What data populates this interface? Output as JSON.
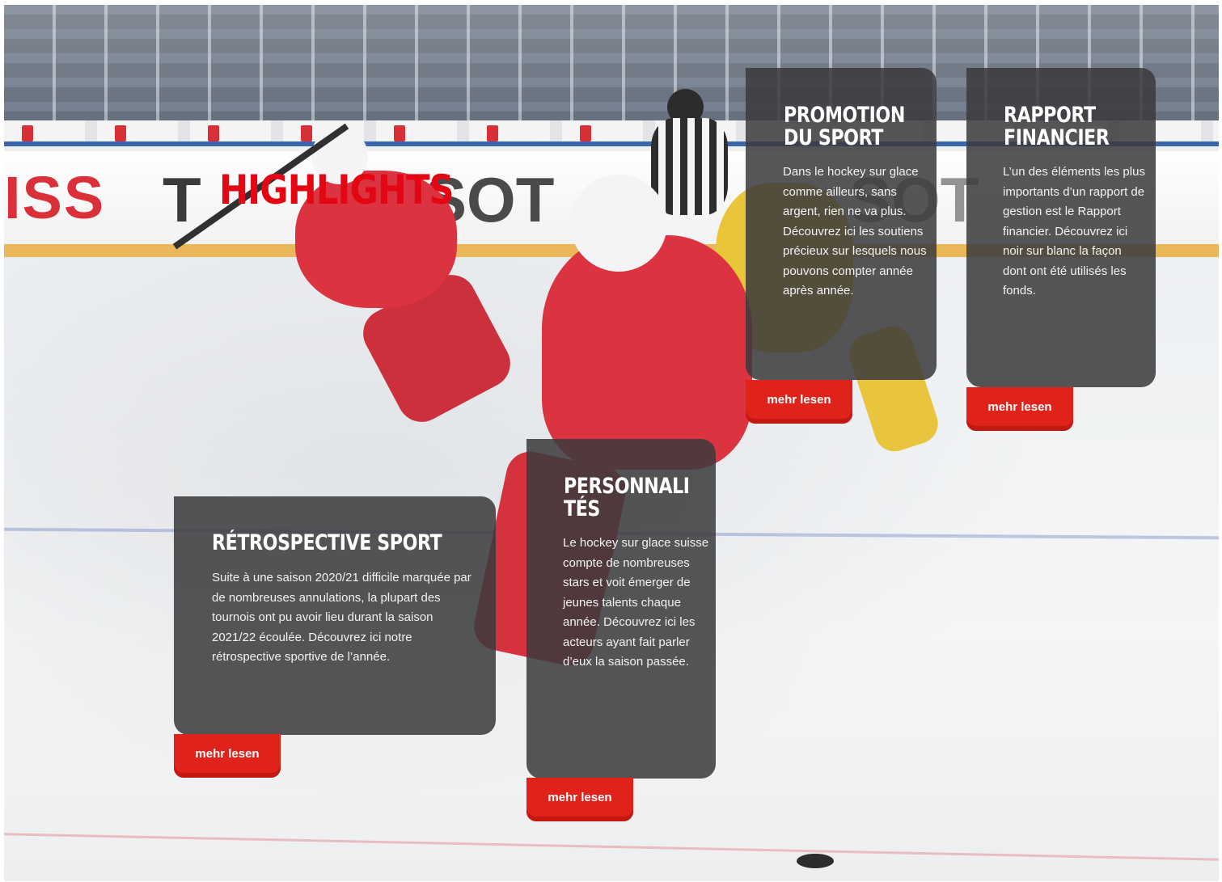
{
  "page": {
    "headline": "HIGHLIGHTS"
  },
  "cards": {
    "promotion": {
      "title": "PROMOTION\nDU SPORT",
      "text": "Dans le hockey sur glace comme ailleurs, sans argent, rien ne va plus. Découvrez ici les soutiens précieux sur lesquels nous pouvons compter année après année.",
      "button": "mehr lesen"
    },
    "rapport": {
      "title": "RAPPORT\nFINANCIER",
      "text": "L’un des éléments les plus importants d’un rapport de gestion est le Rapport financier. Découvrez ici noir sur blanc la façon dont ont été utilisés les fonds.",
      "button": "mehr lesen"
    },
    "retrospective": {
      "title": "RÉTROSPECTIVE SPORT",
      "text": "Suite à une saison 2020/21 difficile marquée par de nombreuses annulations, la plupart des tournois ont pu avoir lieu durant la saison 2021/22 écoulée. Découvrez ici notre rétrospective sportive de l’année.",
      "button": "mehr lesen"
    },
    "personnalites": {
      "title": "PERSONNALI\nTÉS",
      "text": "Le hockey sur glace suisse compte de nombreuses stars et voit émerger de jeunes talents chaque année. Découvrez ici les acteurs ayant fait parler d’eux la saison passée.",
      "button": "mehr lesen"
    }
  },
  "background": {
    "board_text_left": "ISS",
    "board_text_mid": "T",
    "board_text_right": "SOT",
    "board_text_far": "SOT"
  },
  "colors": {
    "accent_red": "#e30613",
    "button_red": "#e0231a",
    "card_bg": "#3a3a3c"
  }
}
